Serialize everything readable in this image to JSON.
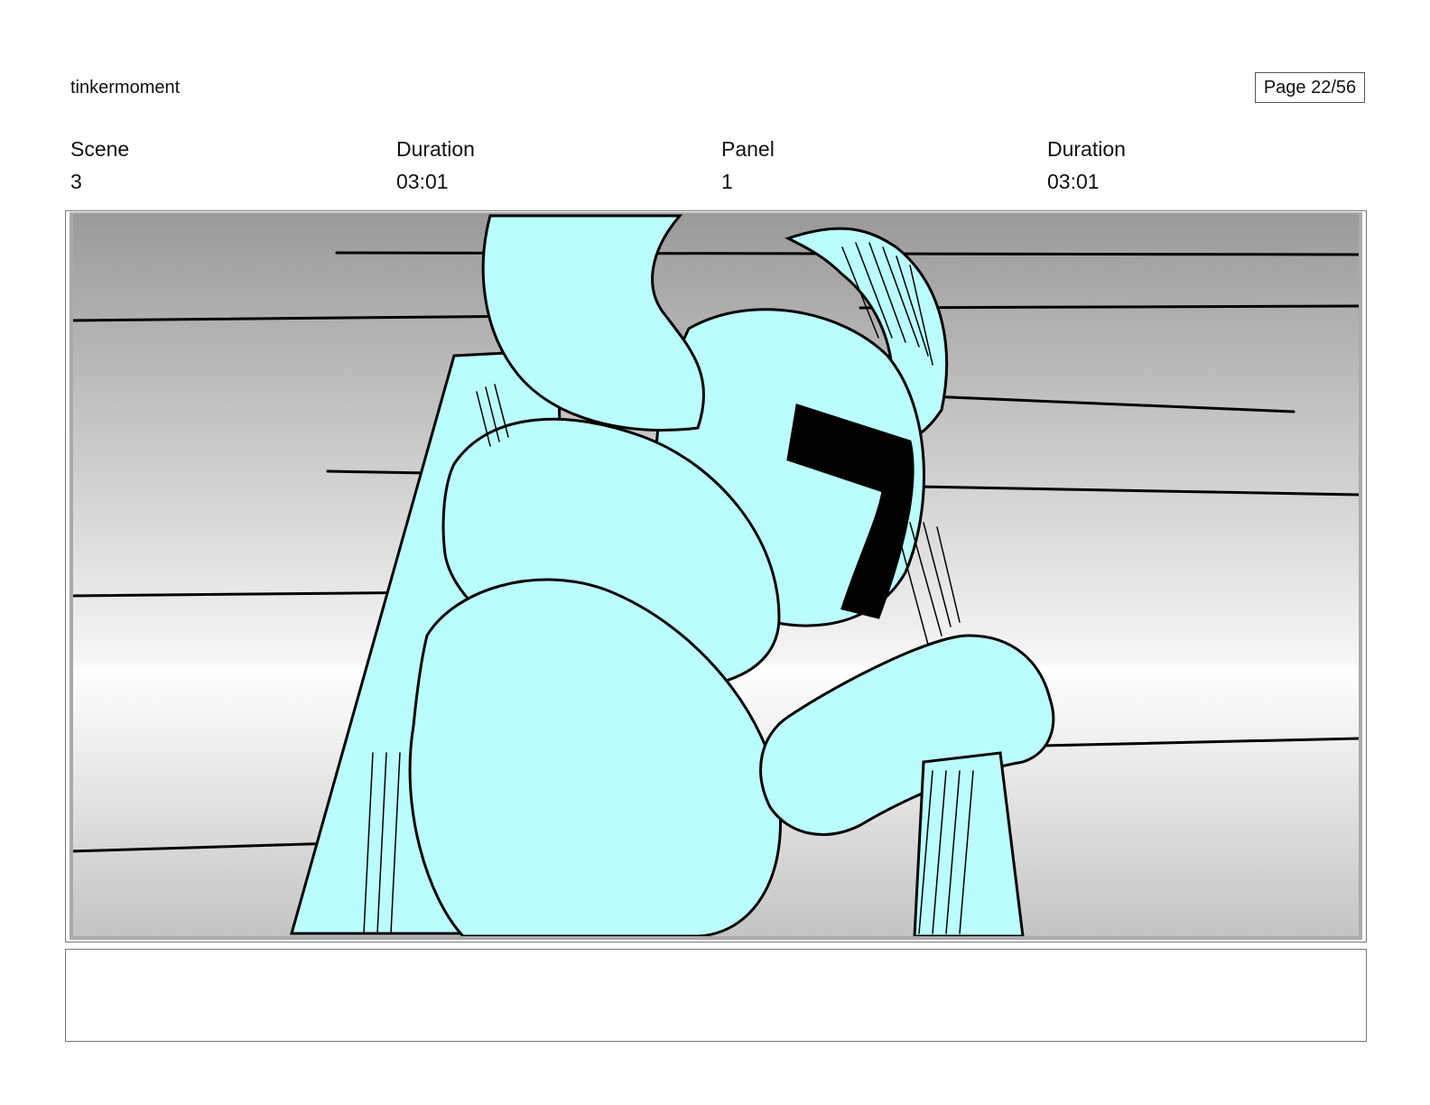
{
  "header": {
    "project_title": "tinkermoment",
    "page_label": "Page 22/56"
  },
  "meta": [
    {
      "label": "Scene",
      "value": "3"
    },
    {
      "label": "Duration",
      "value": "03:01"
    },
    {
      "label": "Panel",
      "value": "1"
    },
    {
      "label": "Duration",
      "value": "03:01"
    }
  ],
  "panel": {
    "description": "",
    "colors": {
      "armor_fill": "#bbfdfd",
      "ink": "#000000",
      "bg_top": "#9a9a9a",
      "bg_band": "#f6f6f6",
      "bg_bottom": "#c4c4c4"
    }
  },
  "notes": {
    "text": ""
  }
}
